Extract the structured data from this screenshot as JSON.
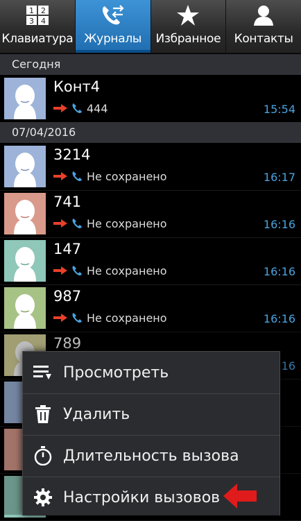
{
  "tabs": [
    {
      "label": "Клавиатура",
      "icon": "keypad-icon",
      "active": false
    },
    {
      "label": "Журналы",
      "icon": "call-log-icon",
      "active": true
    },
    {
      "label": "Избранное",
      "icon": "star-icon",
      "active": false
    },
    {
      "label": "Контакты",
      "icon": "contacts-icon",
      "active": false
    }
  ],
  "sections": {
    "today": "Сегодня",
    "date": "07/04/2016"
  },
  "entries": [
    {
      "name": "Конт4",
      "detail": "444",
      "time": "15:54",
      "avatar_color": "#9db3d9"
    },
    {
      "name": "3214",
      "detail": "Не сохранено",
      "time": "16:17",
      "avatar_color": "#9db3d9"
    },
    {
      "name": "741",
      "detail": "Не сохранено",
      "time": "16:16",
      "avatar_color": "#d99a8c"
    },
    {
      "name": "147",
      "detail": "Не сохранено",
      "time": "16:16",
      "avatar_color": "#8fc7b9"
    },
    {
      "name": "987",
      "detail": "Не сохранено",
      "time": "16:16",
      "avatar_color": "#a6c285"
    },
    {
      "name": "789",
      "detail": "",
      "time": "16:16",
      "avatar_color": "#d7d39a"
    }
  ],
  "menu": {
    "items": [
      {
        "label": "Просмотреть",
        "icon": "view-list-icon"
      },
      {
        "label": "Удалить",
        "icon": "trash-icon"
      },
      {
        "label": "Длительность вызова",
        "icon": "stopwatch-icon"
      },
      {
        "label": "Настройки вызовов",
        "icon": "gear-icon"
      }
    ]
  },
  "colors": {
    "accent": "#3d93d6",
    "time": "#4aa3df",
    "arrow": "#e8402a",
    "phone": "#4aa3df"
  }
}
